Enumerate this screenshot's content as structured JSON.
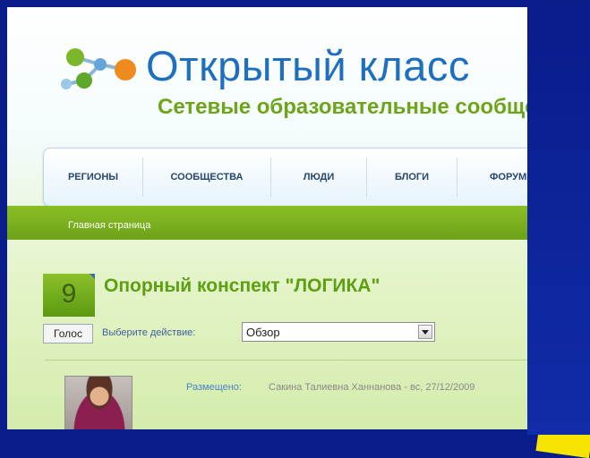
{
  "header": {
    "site_title": "Открытый класс",
    "site_subtitle": "Сетевые образовательные сообщества"
  },
  "nav": {
    "items": [
      {
        "label": "РЕГИОНЫ"
      },
      {
        "label": "СООБЩЕСТВА"
      },
      {
        "label": "ЛЮДИ"
      },
      {
        "label": "БЛОГИ"
      },
      {
        "label": "ФОРУМЫ"
      }
    ]
  },
  "breadcrumb": {
    "home": "Главная страница"
  },
  "vote": {
    "count": "9",
    "button_label": "Голос"
  },
  "content": {
    "title": "Опорный конспект \"ЛОГИКА\"",
    "action_label": "Выберите действие:",
    "action_value": "Обзор",
    "posted_label": "Размещено:",
    "posted_value": "Сакина Талиевна Ханнанова - вс, 27/12/2009"
  },
  "colors": {
    "slide_border": "#0a1b8a",
    "accent_yellow": "#f5e400",
    "green": "#6da21a",
    "title_blue": "#1f6fc0"
  }
}
